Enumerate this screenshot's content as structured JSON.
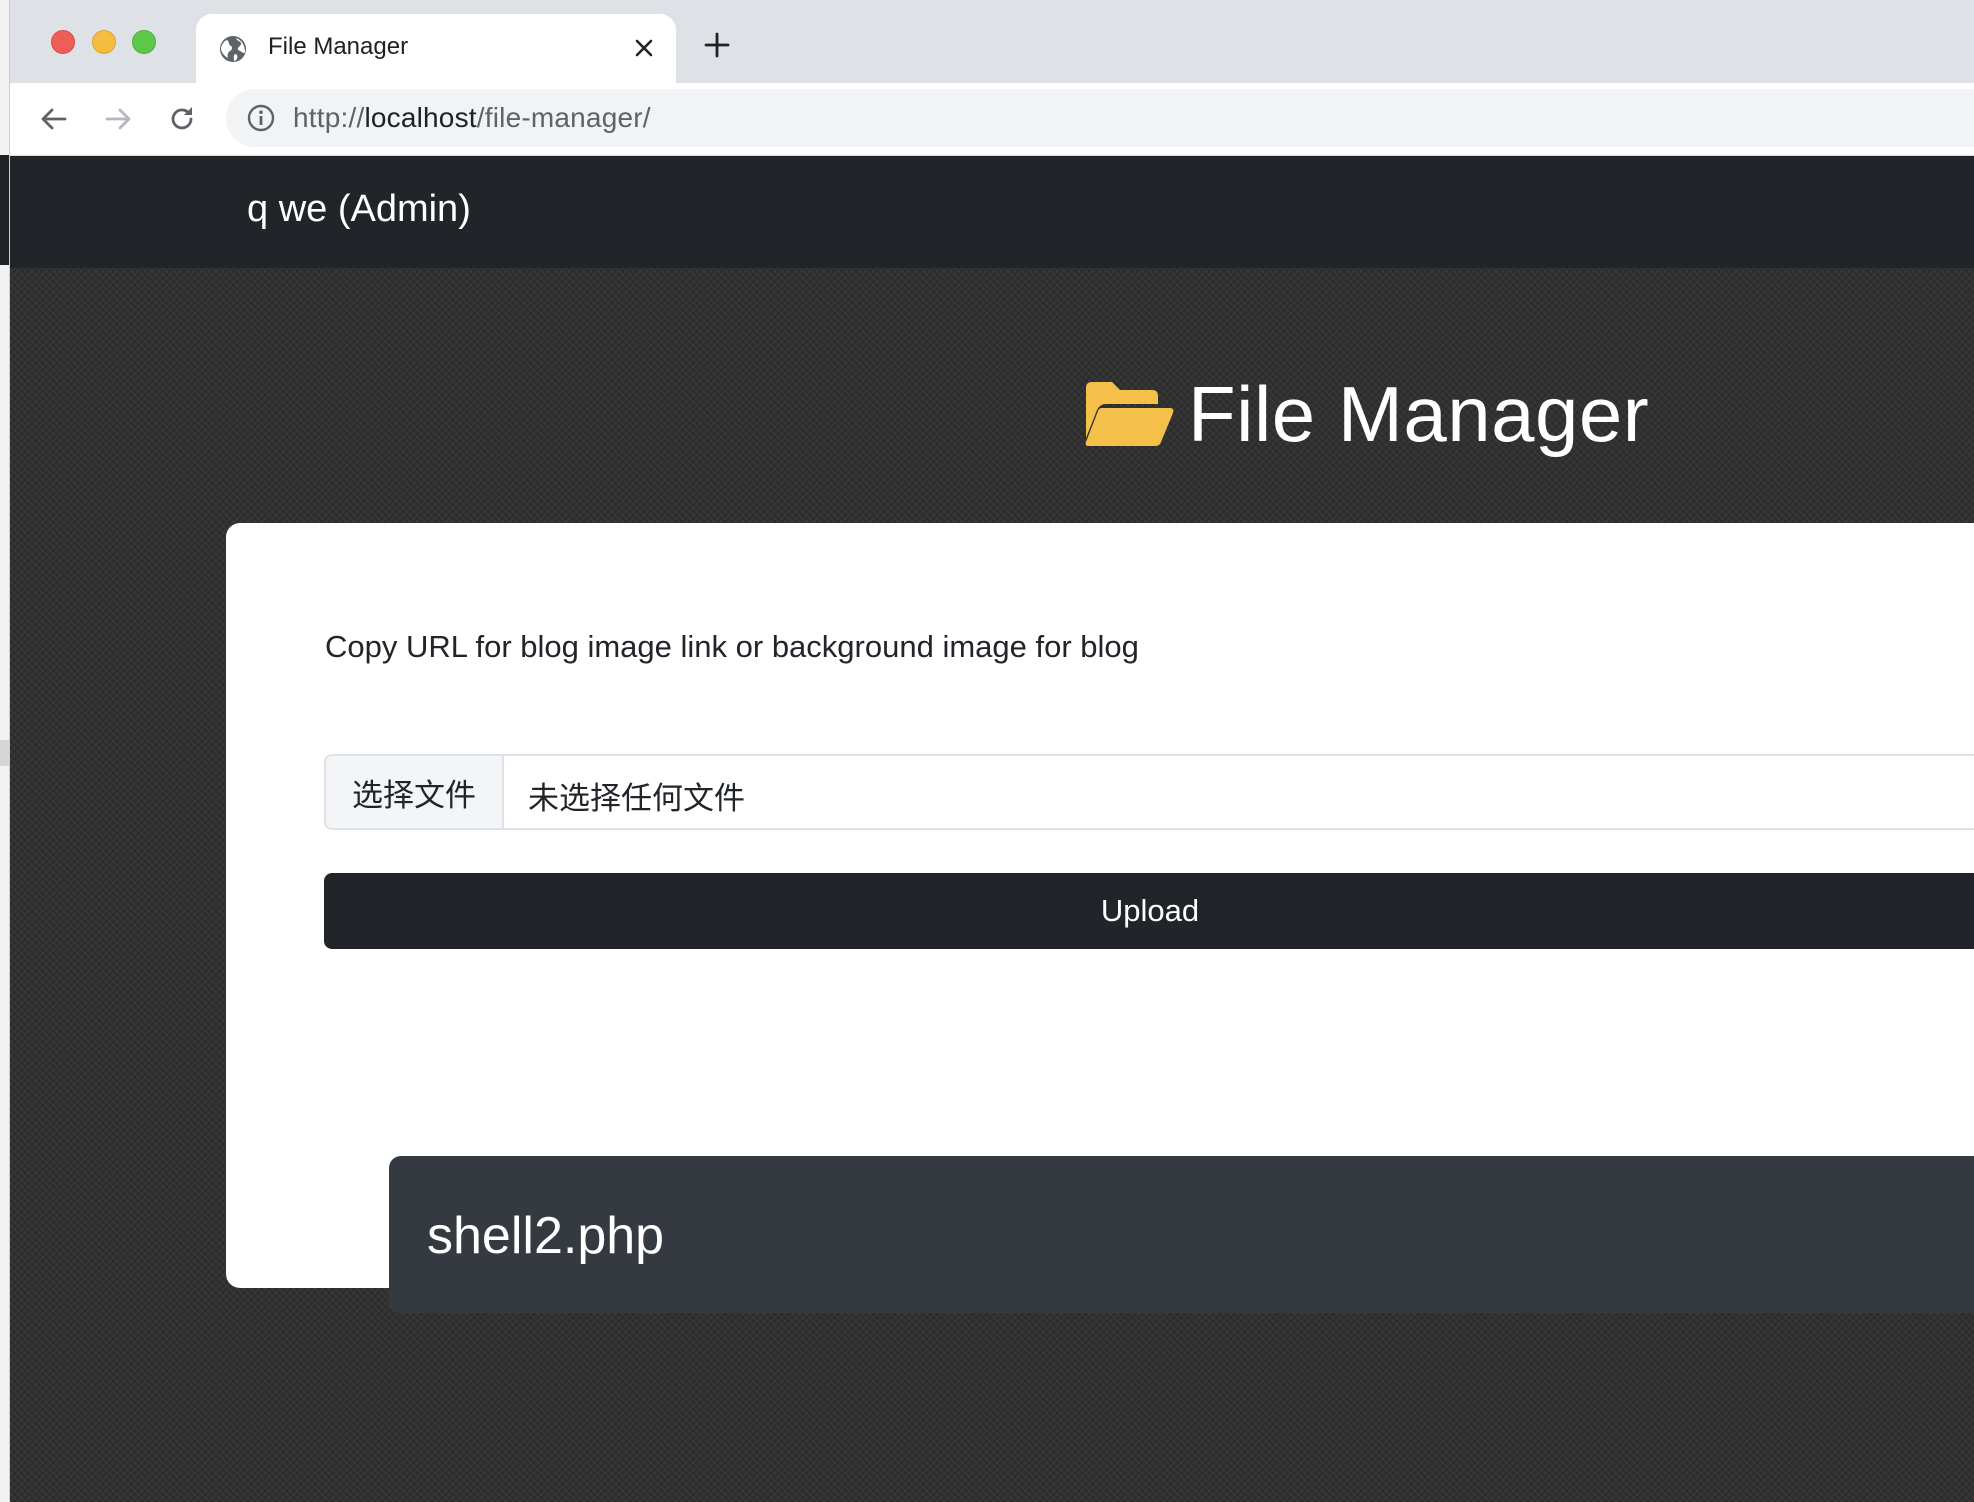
{
  "browser": {
    "tab": {
      "title": "File Manager"
    },
    "address": {
      "scheme": "http://",
      "host": "localhost",
      "path": "/file-manager/"
    }
  },
  "navbar": {
    "brand": "q we (Admin)"
  },
  "page": {
    "title": "File Manager",
    "hint": "Copy URL for blog image link or background image for blog",
    "file_input": {
      "button_label": "选择文件",
      "status": "未选择任何文件"
    },
    "upload_label": "Upload",
    "files": [
      {
        "name": "shell2.php"
      }
    ]
  },
  "colors": {
    "navbar": "#212529",
    "card": "#ffffff",
    "file_item": "#343a40",
    "folder_icon": "#f5c04a"
  },
  "icons": [
    "globe-icon",
    "close-icon",
    "plus-icon",
    "arrow-left-icon",
    "arrow-right-icon",
    "reload-icon",
    "info-icon",
    "open-folder-icon"
  ]
}
